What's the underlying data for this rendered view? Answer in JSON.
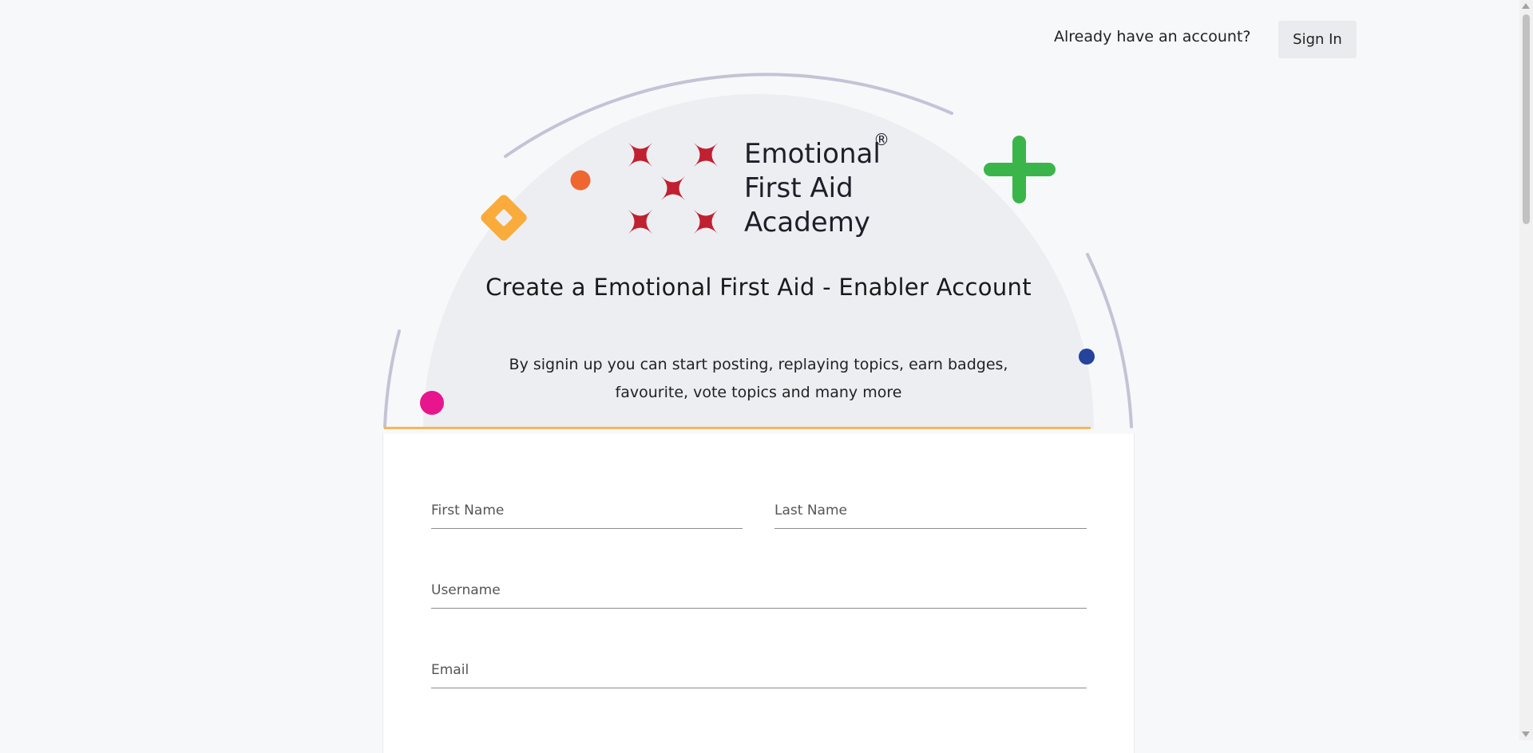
{
  "header": {
    "question": "Already have an account?",
    "sign_in_label": "Sign In"
  },
  "logo": {
    "line1": "Emotional",
    "line2": "First Aid",
    "line3": "Academy",
    "registered_mark": "®",
    "brand_color": "#c0202f"
  },
  "hero": {
    "title": "Create a Emotional First Aid - Enabler Account",
    "subtitle": "By signin up you can start posting, replaying topics, earn badges, favourite, vote topics and many more"
  },
  "form": {
    "first_name_label": "First Name",
    "last_name_label": "Last Name",
    "username_label": "Username",
    "email_label": "Email"
  },
  "decorations": {
    "colors": {
      "arc": "#c4c3d6",
      "dome": "#eceef2",
      "accent_line": "#f7b65b",
      "plus": "#3ab54a",
      "diamond": "#f9ac3c",
      "orange_dot": "#f06630",
      "magenta_dot": "#e8168c",
      "blue_dot": "#23439c"
    }
  }
}
